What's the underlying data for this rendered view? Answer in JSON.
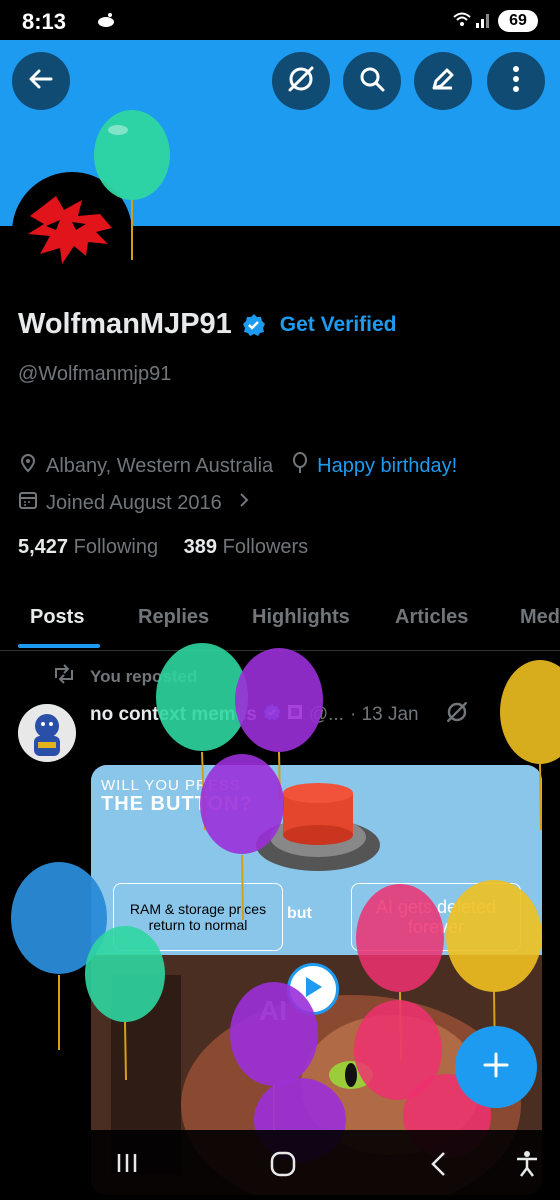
{
  "status_bar": {
    "time": "8:13",
    "battery": "69"
  },
  "header": {
    "back_icon": "arrow-left-icon",
    "grok_icon": "grok-icon",
    "search_icon": "search-icon",
    "edit_icon": "pencil-icon",
    "more_icon": "more-vertical-icon",
    "banner_color": "#1d9bf0"
  },
  "profile": {
    "display_name": "WolfmanMJP91",
    "get_verified": "Get Verified",
    "handle": "@Wolfmanmjp91",
    "location": "Albany, Western Australia",
    "birthday": "Happy birthday!",
    "joined": "Joined August 2016",
    "following_count": "5,427",
    "following_label": "Following",
    "followers_count": "389",
    "followers_label": "Followers"
  },
  "tabs": [
    {
      "label": "Posts",
      "active": true
    },
    {
      "label": "Replies",
      "active": false
    },
    {
      "label": "Highlights",
      "active": false
    },
    {
      "label": "Articles",
      "active": false
    },
    {
      "label": "Med",
      "active": false
    }
  ],
  "post": {
    "repost_label": "You reposted",
    "author": "no context memes",
    "handle": "@...",
    "date": "· 13 Jan",
    "meme": {
      "title_line1": "WILL YOU PRESS",
      "title_line2": "THE BUTTON?",
      "left_box": "RAM & storage prices return to normal",
      "but": "but",
      "right_box": "AI gets deleted forever",
      "bottom_text": "AI"
    }
  },
  "fab_icon": "plus-icon",
  "nav": {
    "recents": "recents-icon",
    "home": "home-icon",
    "back": "back-icon",
    "accessibility": "accessibility-icon"
  },
  "colors": {
    "accent": "#1d9bf0",
    "background": "#000000",
    "muted": "#71767b"
  }
}
